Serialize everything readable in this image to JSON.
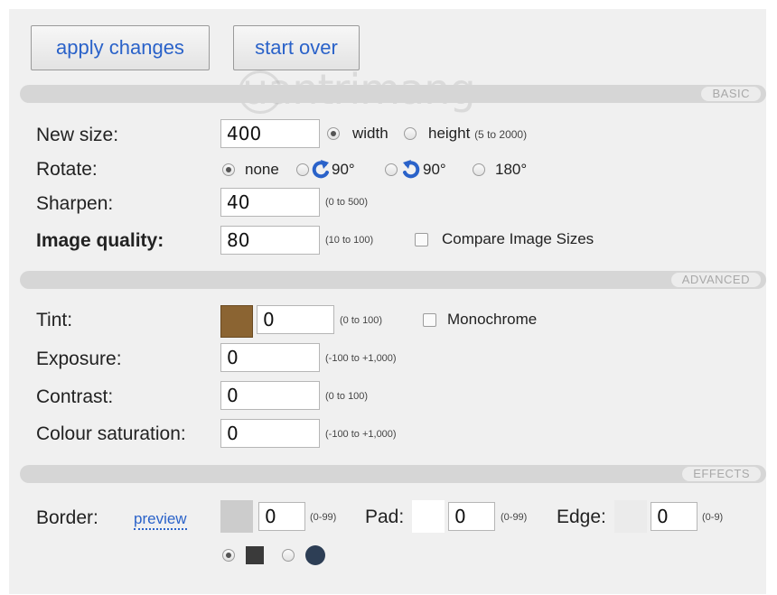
{
  "toolbar": {
    "apply_label": "apply changes",
    "start_over_label": "start over"
  },
  "watermark": {
    "text": "uantrimang"
  },
  "sections": {
    "basic": "BASIC",
    "advanced": "ADVANCED",
    "effects": "EFFECTS"
  },
  "basic": {
    "new_size": {
      "label": "New size:",
      "value": "400",
      "opt_width": "width",
      "opt_height": "height",
      "selected": "width",
      "range": "(5 to 2000)"
    },
    "rotate": {
      "label": "Rotate:",
      "opt_none": "none",
      "opt_cw": "90°",
      "opt_ccw": "90°",
      "opt_180": "180°",
      "selected": "none"
    },
    "sharpen": {
      "label": "Sharpen:",
      "value": "40",
      "range": "(0 to 500)"
    },
    "quality": {
      "label": "Image quality:",
      "value": "80",
      "range": "(10 to 100)",
      "compare_label": "Compare Image Sizes",
      "compare_checked": false
    }
  },
  "advanced": {
    "tint": {
      "label": "Tint:",
      "value": "0",
      "range": "(0 to 100)",
      "swatch_color": "#8b6432",
      "monochrome_label": "Monochrome",
      "monochrome_checked": false
    },
    "exposure": {
      "label": "Exposure:",
      "value": "0",
      "range": "(-100 to +1,000)"
    },
    "contrast": {
      "label": "Contrast:",
      "value": "0",
      "range": "(0 to 100)"
    },
    "saturation": {
      "label": "Colour saturation:",
      "value": "0",
      "range": "(-100 to +1,000)"
    }
  },
  "effects": {
    "border": {
      "label": "Border:",
      "preview_label": "preview",
      "value": "0",
      "range": "(0-99)",
      "swatch_color": "#cccccc"
    },
    "pad": {
      "label": "Pad:",
      "value": "0",
      "range": "(0-99)",
      "swatch_color": "#ffffff"
    },
    "edge": {
      "label": "Edge:",
      "value": "0",
      "range": "(0-9)",
      "swatch_color": "#ebebeb"
    },
    "shape_selected": "square"
  },
  "colors": {
    "accent": "#2a62c9",
    "shape_square": "#3a3a3a",
    "shape_circle": "#2d3e55"
  }
}
